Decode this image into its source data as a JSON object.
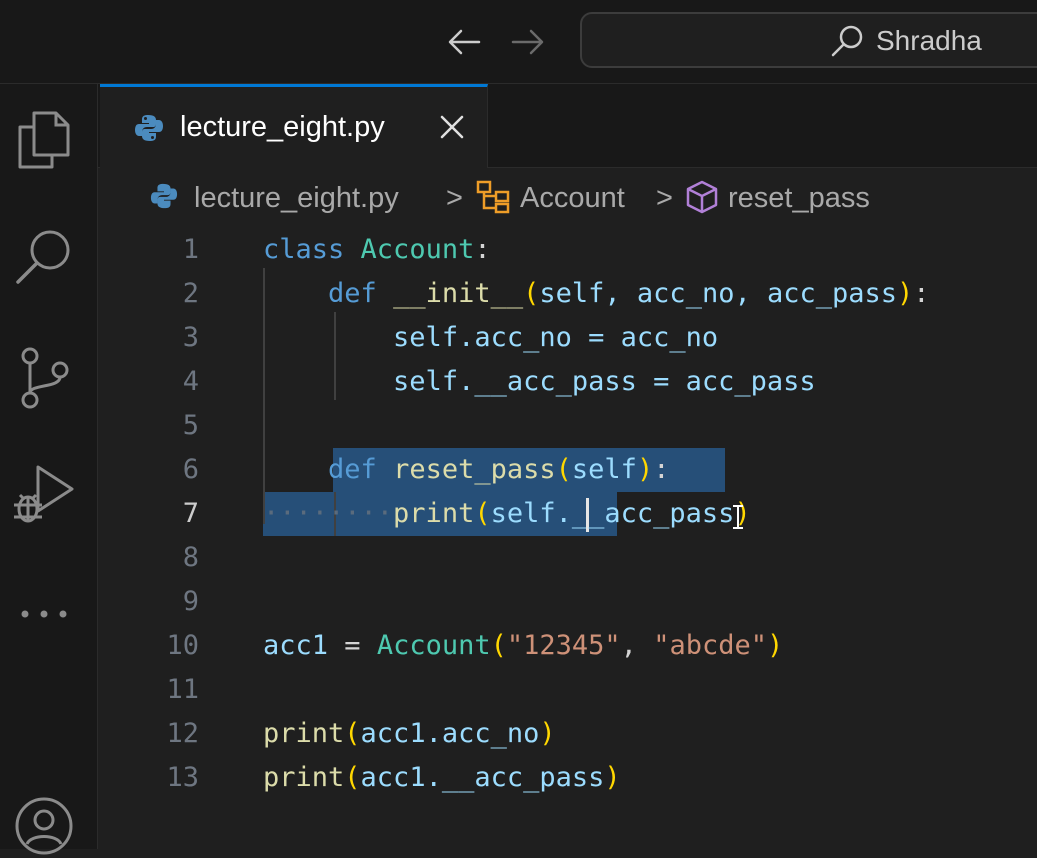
{
  "titlebar": {
    "search_text": "Shradha",
    "back_icon": "arrow-left-icon",
    "forward_icon": "arrow-right-icon"
  },
  "activitybar": {
    "items": [
      "explorer-icon",
      "search-icon",
      "source-control-icon",
      "run-debug-icon",
      "more-icon",
      "account-icon"
    ]
  },
  "tab": {
    "label": "lecture_eight.py",
    "icon": "python-icon",
    "close_icon": "close-icon"
  },
  "breadcrumbs": {
    "file": "lecture_eight.py",
    "class": "Account",
    "method": "reset_pass",
    "separator": ">"
  },
  "editor": {
    "line_numbers": [
      "1",
      "2",
      "3",
      "4",
      "5",
      "6",
      "7",
      "8",
      "9",
      "10",
      "11",
      "12",
      "13"
    ],
    "active_line": "7",
    "lines": {
      "l1": {
        "kw": "class",
        "cls": "Account",
        "colon": ":"
      },
      "l2": {
        "kw": "def",
        "fn": "__init__",
        "open": "(",
        "params": "self, acc_no, acc_pass",
        "close": ")",
        "colon": ":"
      },
      "l3": {
        "text": "self.acc_no = acc_no"
      },
      "l4": {
        "text": "self.__acc_pass = acc_pass"
      },
      "l6": {
        "kw": "def",
        "fn": "reset_pass",
        "open": "(",
        "params": "self",
        "close": ")",
        "colon": ":"
      },
      "l7": {
        "dots": "········",
        "fn": "print",
        "open": "(",
        "a": "self._",
        "b": "_acc_pass",
        "close": ")"
      },
      "l10": {
        "var": "acc1",
        "eq": " = ",
        "cls": "Account",
        "open": "(",
        "s1": "\"12345\"",
        "comma": ", ",
        "s2": "\"abcde\"",
        "close": ")"
      },
      "l12": {
        "fn": "print",
        "open": "(",
        "args": "acc1.acc_no",
        "close": ")"
      },
      "l13": {
        "fn": "print",
        "open": "(",
        "args": "acc1.__acc_pass",
        "close": ")"
      }
    }
  },
  "colors": {
    "background": "#1f1f1f",
    "selection": "#264f78",
    "keyword": "#569cd6",
    "class": "#4ec9b0",
    "function": "#dcdcaa",
    "variable": "#9cdcfe",
    "string": "#ce9178"
  }
}
